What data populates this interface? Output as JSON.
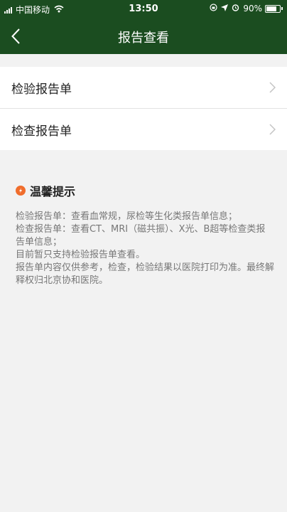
{
  "status_bar": {
    "carrier": "中国移动",
    "time": "13:50",
    "battery_text": "90%",
    "battery_level": 0.9,
    "icons": [
      "signal-icon",
      "wifi-icon",
      "orientation-lock-icon",
      "location-icon",
      "alarm-icon",
      "battery-icon"
    ]
  },
  "nav": {
    "title": "报告查看",
    "back_icon": "chevron-left-icon",
    "background": "#1b4d20"
  },
  "list": {
    "items": [
      {
        "label": "检验报告单",
        "icon": "chevron-right-icon"
      },
      {
        "label": "检查报告单",
        "icon": "chevron-right-icon"
      }
    ]
  },
  "tips": {
    "title": "温馨提示",
    "icon": "tip-icon",
    "icon_color": "#f06d2c",
    "lines": [
      "检验报告单：查看血常规，尿检等生化类报告单信息；",
      "检查报告单：查看CT、MRI（磁共振）、X光、B超等检查类报告单信息；",
      "目前暂只支持检验报告单查看。",
      "报告单内容仅供参考，检查，检验结果以医院打印为准。最终解释权归北京协和医院。"
    ]
  }
}
